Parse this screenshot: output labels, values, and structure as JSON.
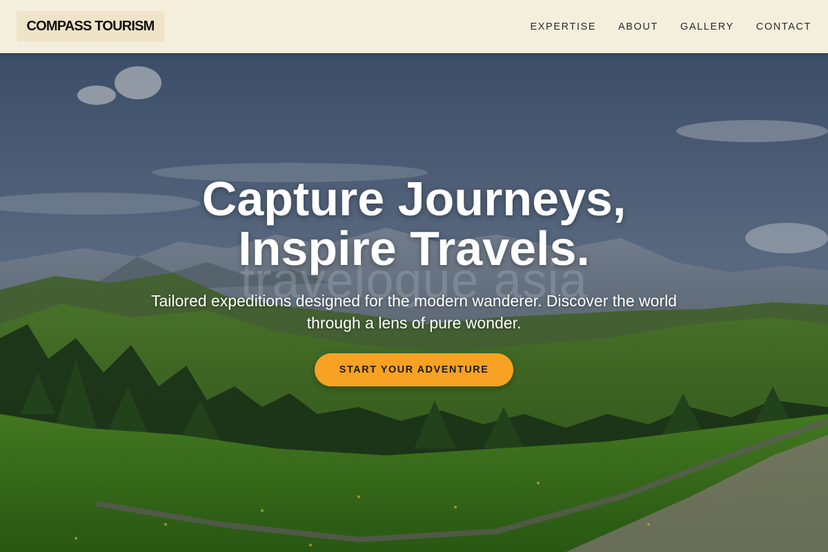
{
  "header": {
    "brand": "COMPASS TOURISM",
    "nav": [
      {
        "label": "EXPERTISE"
      },
      {
        "label": "ABOUT"
      },
      {
        "label": "GALLERY"
      },
      {
        "label": "CONTACT"
      }
    ]
  },
  "hero": {
    "watermark": "travelogue asia",
    "headline_line1": "Capture Journeys,",
    "headline_line2": "Inspire Travels.",
    "subtitle": "Tailored expeditions designed for the modern wanderer. Discover the world through a lens of pure wonder.",
    "cta_label": "START YOUR ADVENTURE"
  },
  "colors": {
    "header_bg": "#f4efdd",
    "brand_bg": "#efe4c7",
    "cta_bg": "#f7a223",
    "headline": "#ffffff"
  }
}
